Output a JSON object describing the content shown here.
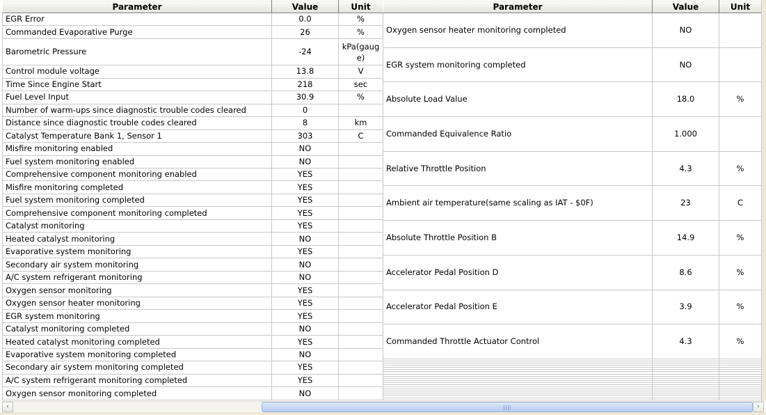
{
  "left_table": {
    "headers": {
      "parameter": "Parameter",
      "value": "Value",
      "unit": "Unit"
    },
    "rows": [
      {
        "parameter": "EGR Error",
        "value": "0.0",
        "unit": "%"
      },
      {
        "parameter": "Commanded Evaporative Purge",
        "value": "26",
        "unit": "%"
      },
      {
        "parameter": "Barometric Pressure",
        "value": "-24",
        "unit": "kPa(gauge)"
      },
      {
        "parameter": "Control module voltage",
        "value": "13.8",
        "unit": "V"
      },
      {
        "parameter": "Time Since Engine Start",
        "value": "218",
        "unit": "sec"
      },
      {
        "parameter": "Fuel Level Input",
        "value": "30.9",
        "unit": "%"
      },
      {
        "parameter": "Number of warm-ups since diagnostic trouble codes cleared",
        "value": "0",
        "unit": ""
      },
      {
        "parameter": "Distance since diagnostic trouble codes cleared",
        "value": "8",
        "unit": "km"
      },
      {
        "parameter": "Catalyst Temperature Bank 1, Sensor 1",
        "value": "303",
        "unit": "C"
      },
      {
        "parameter": "Misfire monitoring enabled",
        "value": "NO",
        "unit": ""
      },
      {
        "parameter": "Fuel system monitoring enabled",
        "value": "NO",
        "unit": ""
      },
      {
        "parameter": "Comprehensive component monitoring enabled",
        "value": "YES",
        "unit": ""
      },
      {
        "parameter": "Misfire monitoring completed",
        "value": "YES",
        "unit": ""
      },
      {
        "parameter": "Fuel system monitoring completed",
        "value": "YES",
        "unit": ""
      },
      {
        "parameter": "Comprehensive component monitoring completed",
        "value": "YES",
        "unit": ""
      },
      {
        "parameter": "Catalyst monitoring",
        "value": "YES",
        "unit": ""
      },
      {
        "parameter": "Heated catalyst monitoring",
        "value": "NO",
        "unit": ""
      },
      {
        "parameter": "Evaporative system monitoring",
        "value": "YES",
        "unit": ""
      },
      {
        "parameter": "Secondary air system monitoring",
        "value": "NO",
        "unit": ""
      },
      {
        "parameter": "A/C system refrigerant monitoring",
        "value": "NO",
        "unit": ""
      },
      {
        "parameter": "Oxygen sensor monitoring",
        "value": "YES",
        "unit": ""
      },
      {
        "parameter": "Oxygen sensor heater monitoring",
        "value": "YES",
        "unit": ""
      },
      {
        "parameter": "EGR system monitoring",
        "value": "YES",
        "unit": ""
      },
      {
        "parameter": "Catalyst monitoring completed",
        "value": "NO",
        "unit": ""
      },
      {
        "parameter": "Heated catalyst monitoring completed",
        "value": "YES",
        "unit": ""
      },
      {
        "parameter": "Evaporative system monitoring completed",
        "value": "NO",
        "unit": ""
      },
      {
        "parameter": "Secondary air system monitoring completed",
        "value": "YES",
        "unit": ""
      },
      {
        "parameter": "A/C system refrigerant monitoring completed",
        "value": "YES",
        "unit": ""
      },
      {
        "parameter": "Oxygen sensor monitoring completed",
        "value": "NO",
        "unit": ""
      }
    ]
  },
  "right_table": {
    "headers": {
      "parameter": "Parameter",
      "value": "Value",
      "unit": "Unit"
    },
    "rows": [
      {
        "parameter": "Oxygen sensor heater monitoring completed",
        "value": "NO",
        "unit": ""
      },
      {
        "parameter": "EGR system monitoring completed",
        "value": "NO",
        "unit": ""
      },
      {
        "parameter": "Absolute Load Value",
        "value": "18.0",
        "unit": "%"
      },
      {
        "parameter": "Commanded Equivalence Ratio",
        "value": "1.000",
        "unit": ""
      },
      {
        "parameter": "Relative Throttle Position",
        "value": "4.3",
        "unit": "%"
      },
      {
        "parameter": "Ambient air temperature(same scaling as IAT - $0F)",
        "value": "23",
        "unit": "C"
      },
      {
        "parameter": "Absolute Throttle Position B",
        "value": "14.9",
        "unit": "%"
      },
      {
        "parameter": "Accelerator Pedal Position D",
        "value": "8.6",
        "unit": "%"
      },
      {
        "parameter": "Accelerator Pedal Position E",
        "value": "3.9",
        "unit": "%"
      },
      {
        "parameter": "Commanded Throttle Actuator Control",
        "value": "4.3",
        "unit": "%"
      }
    ]
  },
  "scrollbar": {
    "left_arrow": "‹",
    "right_arrow": "›"
  }
}
